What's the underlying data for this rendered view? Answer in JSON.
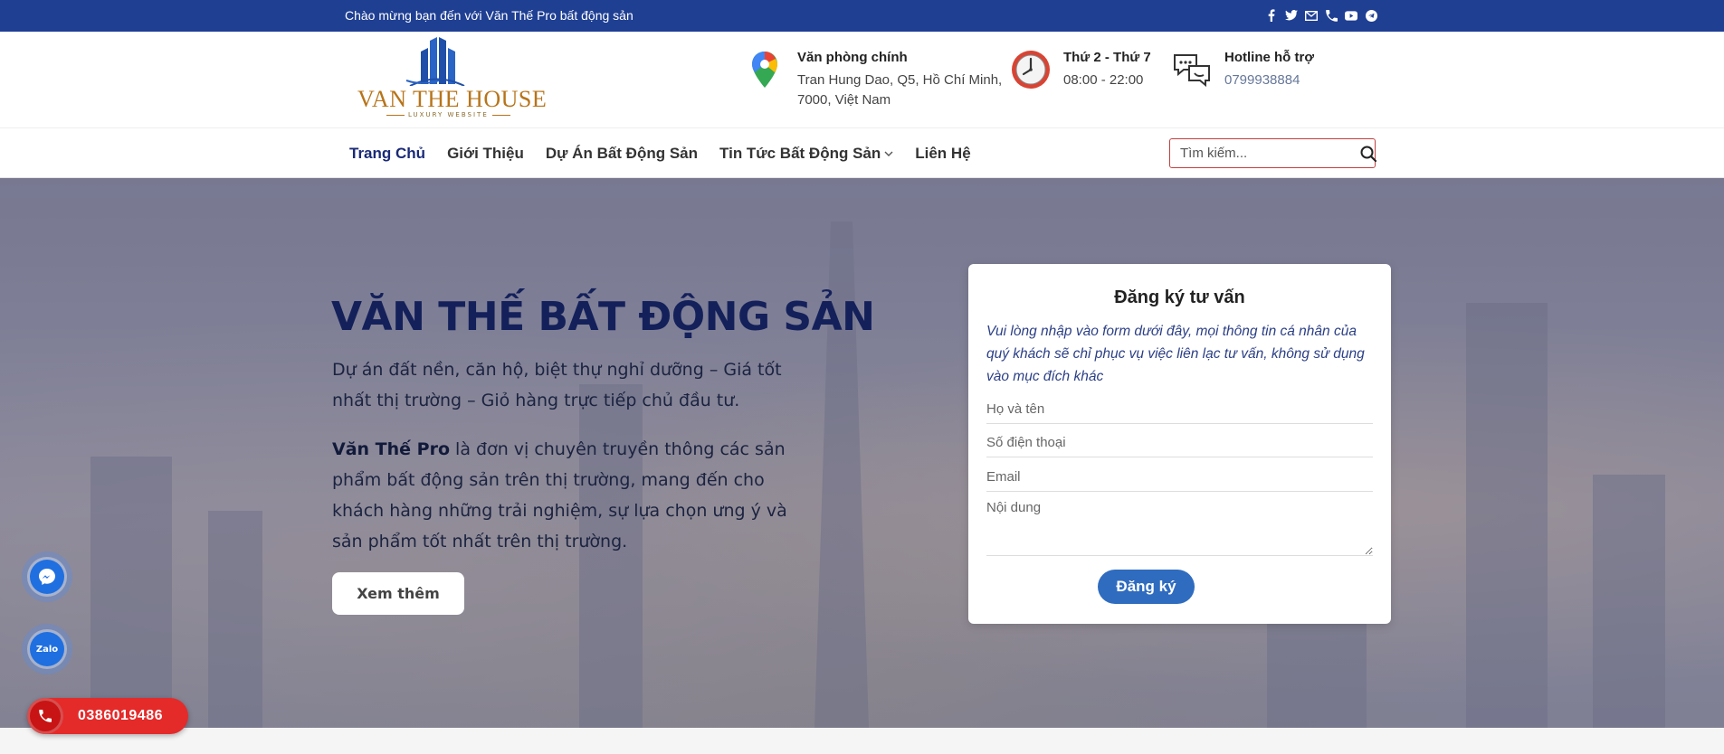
{
  "topbar": {
    "welcome": "Chào mừng bạn đến với Văn Thế Pro bất động sản",
    "socials": [
      "facebook-icon",
      "twitter-icon",
      "email-icon",
      "phone-icon",
      "youtube-icon",
      "telegram-icon"
    ]
  },
  "logo": {
    "brand": "VAN THE HOUSE",
    "tagline": "LUXURY WEBSITE"
  },
  "header_info": {
    "office": {
      "title": "Văn phòng chính",
      "line1": "Tran Hung Dao, Q5, Hồ Chí Minh,",
      "line2": "7000, Việt Nam"
    },
    "hours": {
      "title": "Thứ 2 - Thứ 7",
      "line1": "08:00 - 22:00"
    },
    "hotline": {
      "title": "Hotline hỗ trợ",
      "line1": "0799938884"
    }
  },
  "nav": {
    "items": [
      "Trang Chủ",
      "Giới Thiệu",
      "Dự Án Bất Động Sản",
      "Tin Tức Bất Động Sản",
      "Liên Hệ"
    ],
    "search_placeholder": "Tìm kiếm..."
  },
  "hero": {
    "title": "VĂN THẾ BẤT ĐỘNG SẢN",
    "lead": "Dự án đất nền, căn hộ, biệt thự nghỉ dưỡng – Giá tốt nhất thị trường – Giỏ hàng trực tiếp chủ đầu tư.",
    "desc_strong": "Văn Thế Pro",
    "desc_rest": " là đơn vị chuyên truyền thông các sản phẩm bất động sản trên thị trường, mang đến cho khách hàng những trải nghiệm, sự lựa chọn ưng ý và sản phẩm tốt nhất trên thị trường.",
    "more_label": "Xem thêm"
  },
  "form": {
    "title": "Đăng ký tư vấn",
    "note": "Vui lòng nhập vào form dưới đây, mọi thông tin cá nhân của quý khách sẽ chỉ phục vụ việc liên lạc tư vấn, không sử dụng vào mục đích khác",
    "name_placeholder": "Họ và tên",
    "phone_placeholder": "Số điện thoại",
    "email_placeholder": "Email",
    "content_placeholder": "Nội dung",
    "submit_label": "Đăng ký"
  },
  "floating": {
    "zalo_label": "Zalo",
    "phone_number": "0386019486"
  },
  "colors": {
    "topbar": "#1f3f93",
    "heading": "#14205a",
    "accent_button": "#2f6cc0",
    "phone_pill": "#e52a2a"
  }
}
